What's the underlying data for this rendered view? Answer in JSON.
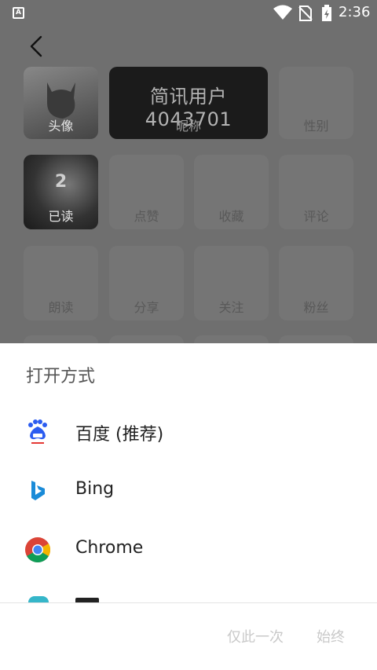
{
  "status_bar": {
    "left_icon": "A",
    "icons": [
      "wifi-icon",
      "no-sim-icon",
      "battery-charging-icon"
    ],
    "time": "2:36"
  },
  "profile_grid": {
    "avatar_label": "头像",
    "nickname_value": "简讯用户4043701",
    "nickname_label": "昵称",
    "gender_label": "性别",
    "read_count": "2",
    "read_label": "已读",
    "likes_label": "点赞",
    "favorites_label": "收藏",
    "comments_label": "评论",
    "readaloud_label": "朗读",
    "share_label": "分享",
    "follow_label": "关注",
    "fans_label": "粉丝"
  },
  "sheet": {
    "title": "打开方式",
    "apps": [
      {
        "name": "百度 (推荐)",
        "icon": "baidu-icon"
      },
      {
        "name": "Bing",
        "icon": "bing-icon"
      },
      {
        "name": "Chrome",
        "icon": "chrome-icon"
      }
    ],
    "just_once": "仅此一次",
    "always": "始终"
  }
}
